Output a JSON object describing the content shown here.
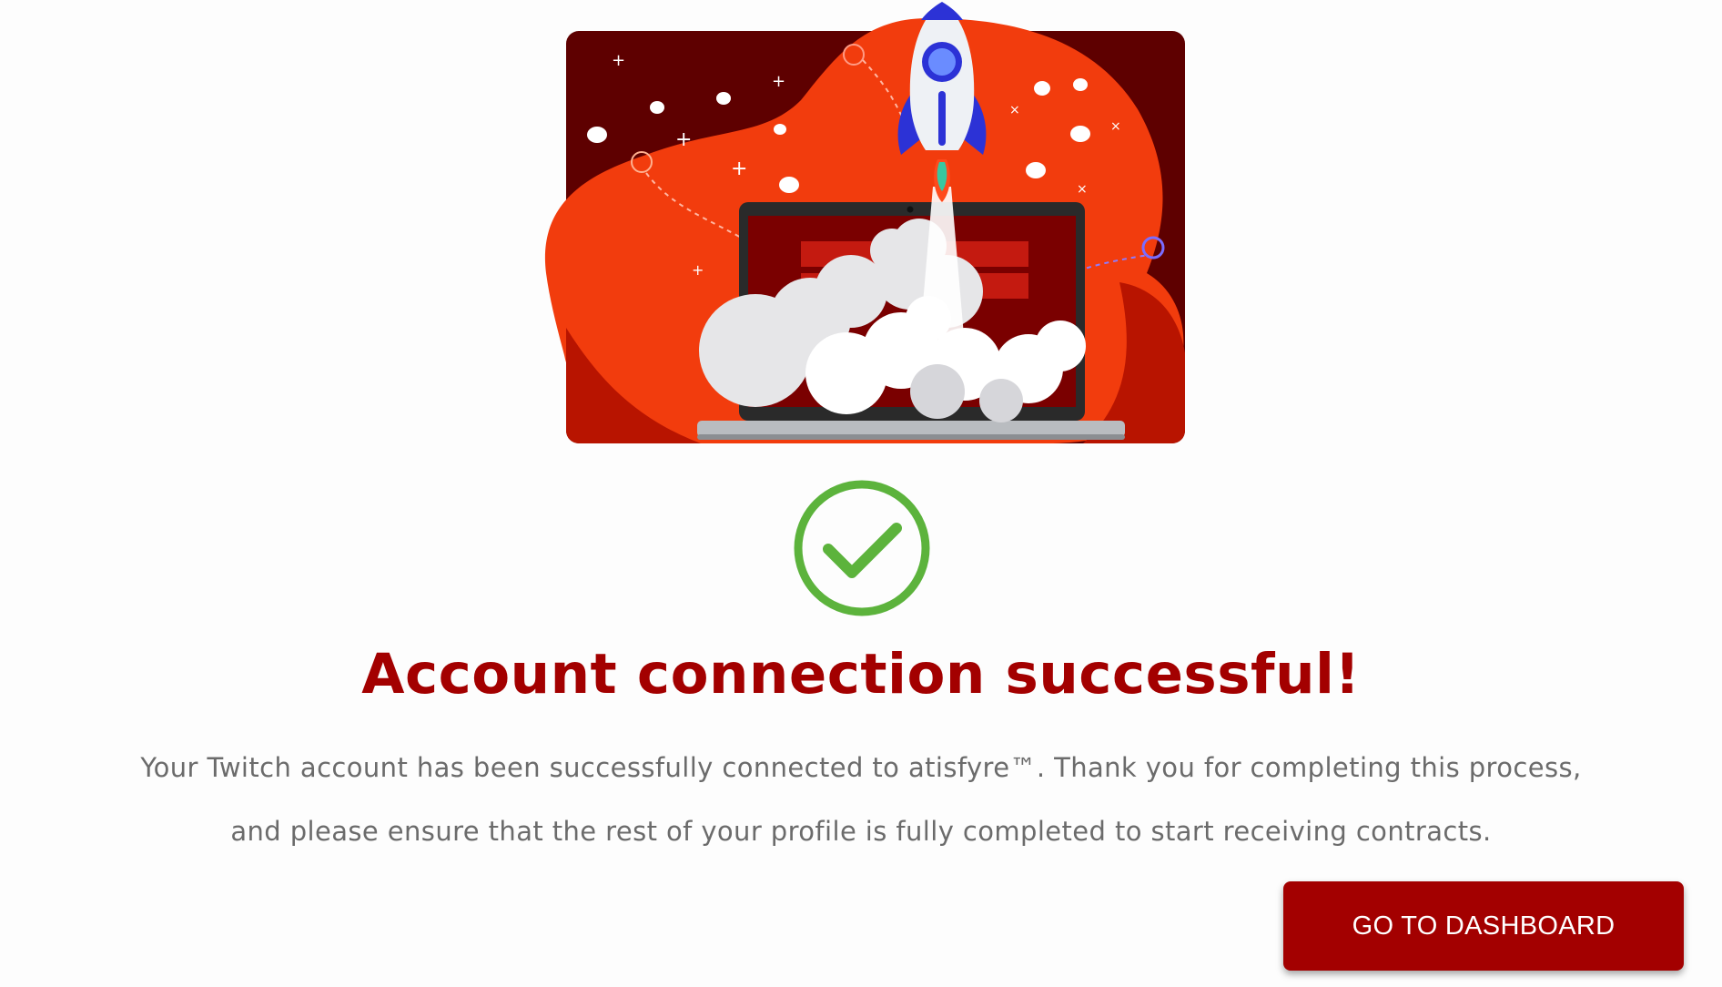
{
  "hero": {
    "illustration": "rocket-launching-from-laptop"
  },
  "status": {
    "icon": "check-circle-icon",
    "color": "#5cb33c"
  },
  "title": "Account connection successful!",
  "message": {
    "line1": "Your Twitch account has been successfully connected to atisfyre™. Thank you for completing this process,",
    "line2": "and please ensure that the rest of your profile is fully completed to start receiving contracts."
  },
  "actions": {
    "dashboard_label": "GO TO DASHBOARD"
  },
  "colors": {
    "brand": "#a30000",
    "text_muted": "#6b6b6b",
    "success": "#5cb33c"
  }
}
